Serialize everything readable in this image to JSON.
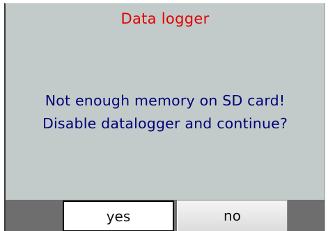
{
  "dialog": {
    "title": "Data logger",
    "message_lines": [
      "Not enough memory on SD card!",
      "Disable datalogger and continue?"
    ]
  },
  "buttons": {
    "yes_label": "yes",
    "no_label": "no"
  },
  "colors": {
    "dialog_background": "#c2cbc9",
    "title": "#e00000",
    "message": "#00007a",
    "button_bar": "#6e6e6e"
  }
}
